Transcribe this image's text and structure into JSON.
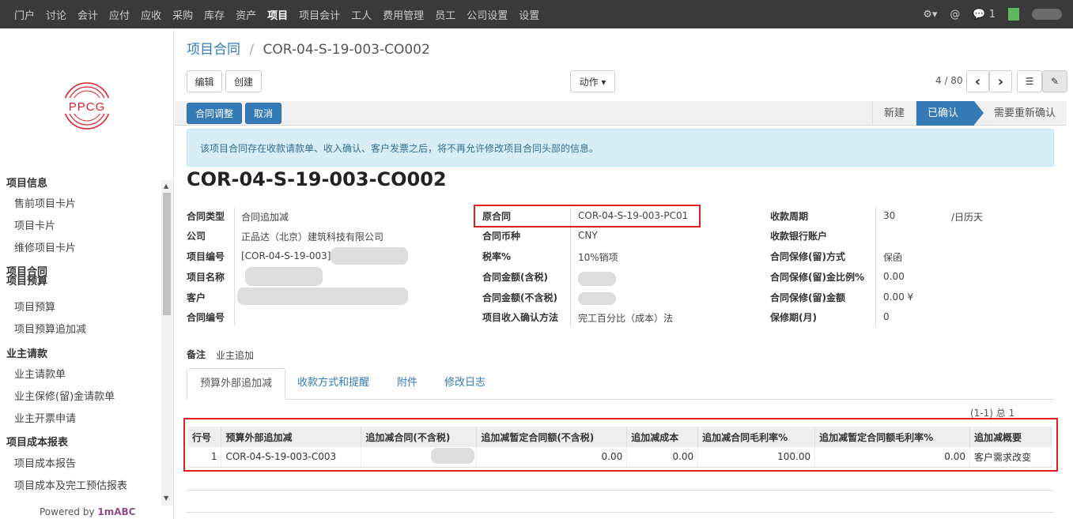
{
  "topnav": {
    "menu": [
      "门户",
      "讨论",
      "会计",
      "应付",
      "应收",
      "采购",
      "库存",
      "资产",
      "项目",
      "项目会计",
      "工人",
      "费用管理",
      "员工",
      "公司设置",
      "设置"
    ],
    "active_index": 8,
    "settings_icon": "⚙▾",
    "mention_icon": "@",
    "messages": "1"
  },
  "sidebar": {
    "logo_text": "PPCG",
    "logo_color": "#d9232d",
    "groups": [
      {
        "title": "项目信息",
        "items": [
          "售前项目卡片",
          "项目卡片",
          "维修项目卡片"
        ]
      },
      {
        "title": "项目合同",
        "items": []
      },
      {
        "title": "项目预算",
        "items": [
          "项目预算",
          "项目预算追加减"
        ]
      },
      {
        "title": "业主请款",
        "items": [
          "业主请款单",
          "业主保修(留)金请款单",
          "业主开票申请"
        ]
      },
      {
        "title": "项目成本报表",
        "items": [
          "项目成本报告",
          "项目成本及完工预估报表"
        ]
      }
    ],
    "powered_prefix": "Powered by ",
    "powered_brand": "1mABC"
  },
  "breadcrumb": {
    "parent": "项目合同",
    "sep": "/",
    "current": "COR-04-S-19-003-CO002"
  },
  "toolbar": {
    "edit": "编辑",
    "create": "创建",
    "action": "动作 ▾",
    "pager": "4 / 80",
    "prev": "‹",
    "next": "›",
    "list_icon": "☰",
    "form_icon": "✎"
  },
  "statusbar": {
    "adjust": "合同调整",
    "cancel": "取消",
    "stages": [
      "新建",
      "已确认",
      "需要重新确认"
    ],
    "current_stage": 1
  },
  "alert": "该项目合同存在收款请款单、收入确认、客户发票之后，将不再允许修改项目合同头部的信息。",
  "record_title": "COR-04-S-19-003-CO002",
  "col1": [
    {
      "label": "合同类型",
      "value": "合同追加减"
    },
    {
      "label": "公司",
      "value": "正品达（北京）建筑科技有限公司"
    },
    {
      "label": "项目编号",
      "value": "[COR-04-S-19-003]"
    },
    {
      "label": "项目名称",
      "value": ""
    },
    {
      "label": "客户",
      "value": ""
    },
    {
      "label": "合同编号",
      "value": ""
    }
  ],
  "col2": [
    {
      "label": "原合同",
      "value": "COR-04-S-19-003-PC01"
    },
    {
      "label": "合同币种",
      "value": "CNY"
    },
    {
      "label": "税率%",
      "value": "10%销项"
    },
    {
      "label": "合同金额(含税)",
      "value": ""
    },
    {
      "label": "合同金额(不含税)",
      "value": ""
    },
    {
      "label": "项目收入确认方法",
      "value": "完工百分比（成本）法"
    }
  ],
  "col3": [
    {
      "label": "收款周期",
      "value": "30",
      "unit": "/日历天"
    },
    {
      "label": "收款银行账户",
      "value": ""
    },
    {
      "label": "合同保修(留)方式",
      "value": "保函"
    },
    {
      "label": "合同保修(留)金比例%",
      "value": "0.00"
    },
    {
      "label": "合同保修(留)金额",
      "value": "0.00 ¥"
    },
    {
      "label": "保修期(月)",
      "value": "0"
    }
  ],
  "remark": {
    "label": "备注",
    "value": "业主追加"
  },
  "tabs": [
    "预算外部追加减",
    "收款方式和提醒",
    "附件",
    "修改日志"
  ],
  "table": {
    "count": "(1-1) 总 1",
    "headers": [
      "行号",
      "预算外部追加减",
      "追加减合同(不含税)",
      "追加减暂定合同额(不含税)",
      "追加减成本",
      "追加减合同毛利率%",
      "追加减暂定合同额毛利率%",
      "追加减概要"
    ],
    "rows": [
      [
        "1",
        "COR-04-S-19-003-C003",
        "",
        "0.00",
        "0.00",
        "100.00",
        "0.00",
        "客户需求改变"
      ]
    ]
  }
}
